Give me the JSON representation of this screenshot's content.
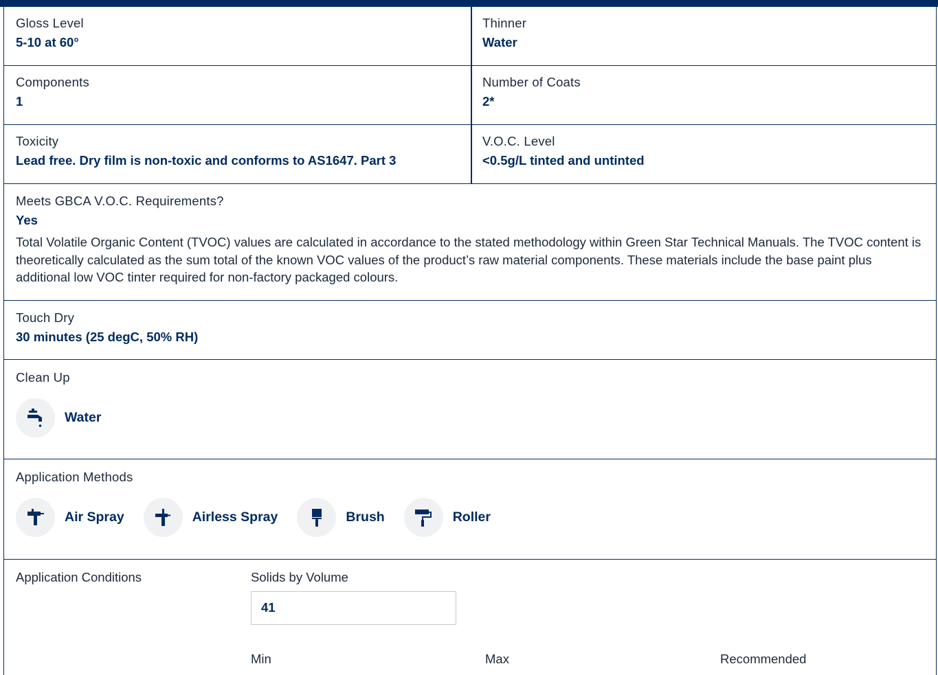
{
  "props": {
    "gloss": {
      "label": "Gloss Level",
      "value": "5-10 at 60°"
    },
    "thinner": {
      "label": "Thinner",
      "value": "Water"
    },
    "components": {
      "label": "Components",
      "value": "1"
    },
    "coats": {
      "label": "Number of Coats",
      "value": "2*"
    },
    "toxicity": {
      "label": "Toxicity",
      "value": "Lead free. Dry film is non-toxic and conforms to AS1647. Part 3"
    },
    "voc": {
      "label": "V.O.C. Level",
      "value": "<0.5g/L tinted and untinted"
    },
    "gbca": {
      "label": "Meets GBCA V.O.C. Requirements?",
      "value": "Yes",
      "note": "Total Volatile Organic Content (TVOC) values are calculated in accordance to the stated methodology within Green Star Technical Manuals. The TVOC content is theoretically calculated as the sum total of the known VOC values of the product’s raw material components. These materials include the base paint plus additional low VOC tinter required for non-factory packaged colours."
    },
    "touch_dry": {
      "label": "Touch Dry",
      "value": "30 minutes (25 degC, 50% RH)"
    }
  },
  "clean_up": {
    "label": "Clean Up",
    "items": [
      {
        "label": "Water",
        "icon": "tap-icon"
      }
    ]
  },
  "application_methods": {
    "label": "Application Methods",
    "items": [
      {
        "label": "Air Spray",
        "icon": "air-spray-gun-icon"
      },
      {
        "label": "Airless Spray",
        "icon": "airless-spray-gun-icon"
      },
      {
        "label": "Brush",
        "icon": "brush-icon"
      },
      {
        "label": "Roller",
        "icon": "roller-icon"
      }
    ]
  },
  "application_conditions": {
    "label": "Application Conditions",
    "solids_label": "Solids by Volume",
    "solids_value": "41",
    "columns": [
      "Min",
      "Max",
      "Recommended"
    ]
  },
  "colors": {
    "primary": "#002b62",
    "icon_bg": "#f0f1f3",
    "text": "#1b2a3d"
  }
}
